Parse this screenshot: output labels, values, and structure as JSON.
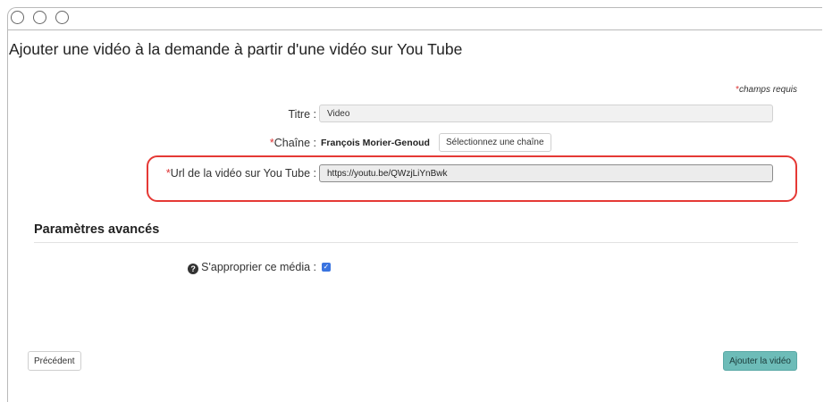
{
  "page": {
    "title": "Ajouter une vidéo à la demande à partir d'une vidéo sur You Tube",
    "required_star": "*",
    "required_note": "champs requis"
  },
  "form": {
    "title_label": "Titre :",
    "title_value": "Video",
    "channel_star": "*",
    "channel_label": "Chaîne :",
    "channel_value": "François Morier-Genoud",
    "channel_button": "Sélectionnez une chaîne",
    "url_star": "*",
    "url_label": "Url de la vidéo sur You Tube :",
    "url_value": "https://youtu.be/QWzjLiYnBwk"
  },
  "advanced": {
    "title": "Paramètres avancés",
    "help_icon_glyph": "?",
    "appropriate_label": "S'approprier ce média :",
    "appropriate_checked": true,
    "check_glyph": "✓"
  },
  "actions": {
    "previous_label": "Précédent",
    "submit_label": "Ajouter la vidéo"
  },
  "colors": {
    "highlight": "#e53935",
    "required": "#d33333",
    "primary_button": "#6dbcb8",
    "checkbox": "#3a74e0"
  }
}
